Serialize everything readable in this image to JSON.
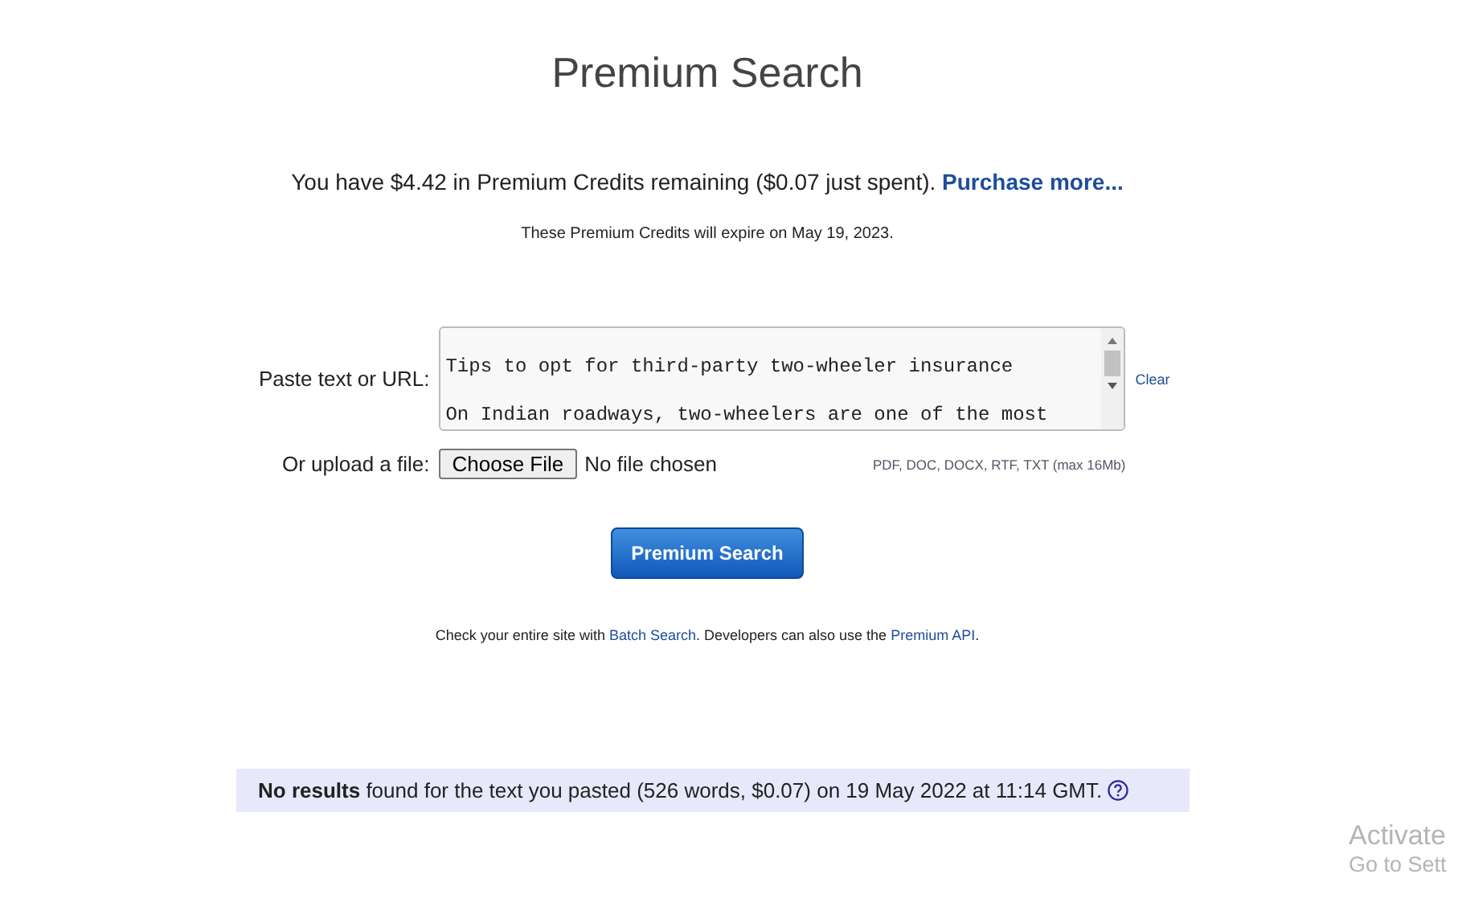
{
  "title": "Premium Search",
  "credits": [
    {
      "kind": "text",
      "text": "You have $4.42 in Premium Credits remaining ($0.07 just spent). "
    },
    {
      "kind": "link",
      "text": "Purchase more..."
    }
  ],
  "expiry": "These Premium Credits will expire on May 19, 2023.",
  "paste": {
    "label": "Paste text or URL:",
    "lines": [
      "Tips to opt for third-party two-wheeler insurance",
      "On Indian roadways, two-wheelers are one of the most"
    ],
    "clear": "Clear"
  },
  "upload": {
    "label": "Or upload a file:",
    "button": "Choose File",
    "status": "No file chosen",
    "formats": "PDF, DOC, DOCX, RTF, TXT (max 16Mb)"
  },
  "search_button": "Premium Search",
  "note": [
    {
      "kind": "text",
      "text": "Check your entire site with "
    },
    {
      "kind": "link",
      "text": "Batch Search"
    },
    {
      "kind": "text",
      "text": ". Developers can also use the "
    },
    {
      "kind": "link",
      "text": "Premium API"
    },
    {
      "kind": "text",
      "text": "."
    }
  ],
  "result": "**No results** found for the text you pasted (526 words, $0.07) on 19 May 2022 at 11:14 GMT.",
  "os_overlay": [
    "Activate",
    "Go to Sett"
  ]
}
